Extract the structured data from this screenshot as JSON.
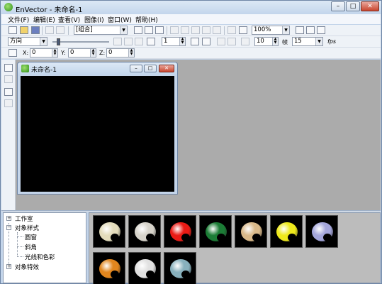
{
  "window": {
    "title": "EnVector - 未命名-1"
  },
  "menu": [
    "文件(F)",
    "编辑(E)",
    "查看(V)",
    "图像(I)",
    "窗口(W)",
    "帮助(H)"
  ],
  "toolbar1": {
    "group_combo": "[组合]",
    "zoom_combo": "100%"
  },
  "toolbar2": {
    "direction_combo": "方向",
    "spin_step": "1",
    "spin_frame": "10",
    "frame_label": "帧",
    "spin_fps": "15",
    "fps_label": "fps"
  },
  "toolbar3": {
    "x_label": "X:",
    "y_label": "Y:",
    "z_label": "Z:",
    "x_value": "0",
    "y_value": "0",
    "z_value": "0"
  },
  "document": {
    "title": "未命名-1"
  },
  "tree": {
    "items": [
      {
        "label": "工作室",
        "expander": "+"
      },
      {
        "label": "对象样式",
        "expander": "−"
      },
      {
        "label": "圆窗"
      },
      {
        "label": "斜角"
      },
      {
        "label": "光线和色彩"
      },
      {
        "label": "对象特效",
        "expander": "+"
      }
    ]
  },
  "gallery": {
    "styles": [
      {
        "color": "#e3dcbb"
      },
      {
        "color": "#d7d4cb"
      },
      {
        "color": "#ea1b15"
      },
      {
        "color": "#1c7d36"
      },
      {
        "color": "#d9b98a"
      },
      {
        "color": "#eee91c"
      },
      {
        "color": "#a4a6db"
      },
      {
        "color": "#e2861e"
      },
      {
        "color": "#e1e1e1"
      },
      {
        "color": "#88b1bd"
      }
    ]
  }
}
